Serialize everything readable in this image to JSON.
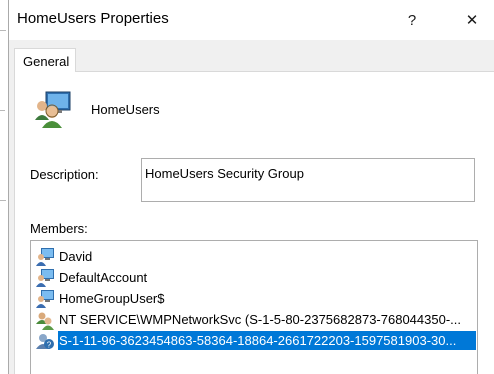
{
  "window": {
    "title": "HomeUsers Properties",
    "help_glyph": "?",
    "close_glyph": "✕"
  },
  "tabs": [
    {
      "label": "General",
      "active": true
    }
  ],
  "group": {
    "icon": "group-users-icon",
    "name": "HomeUsers"
  },
  "description": {
    "label": "Description:",
    "value": "HomeUsers Security Group"
  },
  "members": {
    "label": "Members:",
    "items": [
      {
        "name": "David",
        "icon": "user-monitor-icon",
        "selected": false
      },
      {
        "name": "DefaultAccount",
        "icon": "user-monitor-icon",
        "selected": false
      },
      {
        "name": "HomeGroupUser$",
        "icon": "user-monitor-icon",
        "selected": false
      },
      {
        "name": "NT SERVICE\\WMPNetworkSvc (S-1-5-80-2375682873-768044350-...",
        "icon": "service-group-icon",
        "selected": false
      },
      {
        "name": "S-1-11-96-3623454863-58364-18864-2661722203-1597581903-30...",
        "icon": "unknown-sid-icon",
        "selected": true
      }
    ]
  },
  "colors": {
    "selection": "#0078d7",
    "dialog_bg": "#f0f0f0"
  }
}
